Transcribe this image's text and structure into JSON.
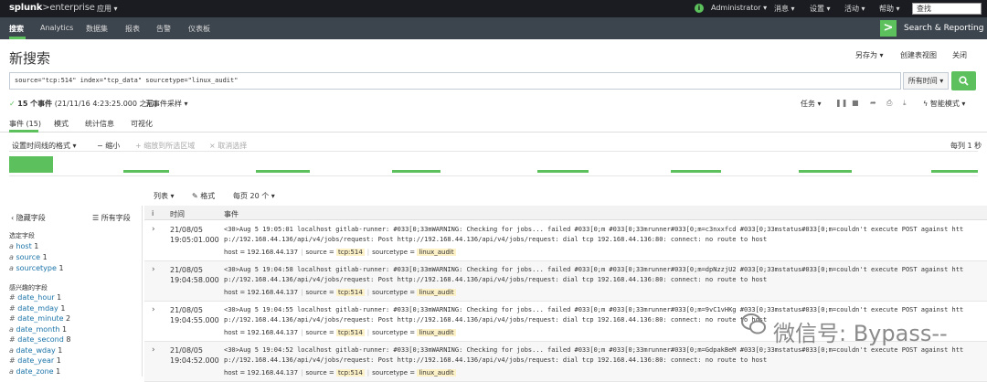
{
  "top": {
    "logo_main": "splunk",
    "logo_sub": ">enterprise",
    "app_menu": "应用 ▾",
    "user": "Administrator ▾",
    "messages": "消息 ▾",
    "settings": "设置 ▾",
    "activity": "活动 ▾",
    "help": "帮助 ▾",
    "find_placeholder": "查找",
    "status_glyph": "i"
  },
  "nav": {
    "items": [
      "搜索",
      "Analytics",
      "数据集",
      "报表",
      "告警",
      "仪表板"
    ],
    "app_glyph": ">",
    "app_name": "Search & Reporting"
  },
  "page": {
    "title": "新搜索",
    "save_as": "另存为 ▾",
    "create_dashboard": "创建表视图",
    "close": "关闭"
  },
  "search": {
    "query": "source=\"tcp:514\" index=\"tcp_data\" sourcetype=\"linux_audit\"",
    "time_range": "所有时间 ▾"
  },
  "meta": {
    "check": "✓",
    "count": "15 个事件",
    "time": "(21/11/16 4:23:25.000 之前)",
    "sampling": "无事件采样 ▾",
    "job": "任务 ▾",
    "mode": "智能模式 ▾"
  },
  "tabs": [
    "事件 (15)",
    "模式",
    "统计信息",
    "可视化"
  ],
  "timeline_ctrl": {
    "format": "设置时间线的格式 ▾",
    "zoom_out": "− 缩小",
    "zoom_sel": "+ 缩放到所选区域",
    "deselect": "× 取消选择",
    "scale": "每列 1 秒"
  },
  "timeline_data": {
    "bars": [
      {
        "start": 0.0,
        "end": 0.045,
        "height": 1.0
      },
      {
        "start": 0.118,
        "end": 0.165,
        "height": 0.15
      },
      {
        "start": 0.255,
        "end": 0.31,
        "height": 0.15
      },
      {
        "start": 0.395,
        "end": 0.445,
        "height": 0.15
      },
      {
        "start": 0.545,
        "end": 0.598,
        "height": 0.15
      },
      {
        "start": 0.683,
        "end": 0.735,
        "height": 0.15
      },
      {
        "start": 0.815,
        "end": 0.87,
        "height": 0.15
      },
      {
        "start": 0.952,
        "end": 1.0,
        "height": 0.15
      }
    ]
  },
  "results_ctrl": {
    "list": "列表 ▾",
    "format": "✎ 格式",
    "per_page": "每页 20 个 ▾"
  },
  "sidebar": {
    "hide_fields": "‹ 隐藏字段",
    "all_fields": "☰ 所有字段",
    "selected_title": "选定字段",
    "interesting_title": "感兴趣的字段",
    "selected": [
      {
        "type": "a",
        "name": "host",
        "count": "1"
      },
      {
        "type": "a",
        "name": "source",
        "count": "1"
      },
      {
        "type": "a",
        "name": "sourcetype",
        "count": "1"
      }
    ],
    "interesting": [
      {
        "type": "#",
        "name": "date_hour",
        "count": "1"
      },
      {
        "type": "#",
        "name": "date_mday",
        "count": "1"
      },
      {
        "type": "#",
        "name": "date_minute",
        "count": "2"
      },
      {
        "type": "a",
        "name": "date_month",
        "count": "1"
      },
      {
        "type": "#",
        "name": "date_second",
        "count": "8"
      },
      {
        "type": "a",
        "name": "date_wday",
        "count": "1"
      },
      {
        "type": "#",
        "name": "date_year",
        "count": "1"
      },
      {
        "type": "a",
        "name": "date_zone",
        "count": "1"
      }
    ]
  },
  "table": {
    "col_info": "i",
    "col_time": "时间",
    "col_event": "事件",
    "expand_glyph": "›",
    "rows": [
      {
        "date": "21/08/05",
        "time": "19:05:01.000",
        "line1": "<30>Aug  5 19:05:01 localhost gitlab-runner: #033[0;33mWARNING: Checking for jobs... failed              #033[0;m  #033[0;33mrunner#033[0;m=c3nxxfcd #033[0;33mstatus#033[0;m=couldn't execute POST against htt",
        "line2": "p://192.168.44.136/api/v4/jobs/request: Post http://192.168.44.136/api/v4/jobs/request: dial tcp 192.168.44.136:80: connect: no route to host",
        "host": "host = 192.168.44.137",
        "source_label": "source =",
        "source_val": "tcp:514",
        "st_label": "sourcetype =",
        "st_val": "linux_audit"
      },
      {
        "date": "21/08/05",
        "time": "19:04:58.000",
        "line1": "<30>Aug  5 19:04:58 localhost gitlab-runner: #033[0;33mWARNING: Checking for jobs... failed              #033[0;m  #033[0;33mrunner#033[0;m=dpNzzjU2 #033[0;33mstatus#033[0;m=couldn't execute POST against htt",
        "line2": "p://192.168.44.136/api/v4/jobs/request: Post http://192.168.44.136/api/v4/jobs/request: dial tcp 192.168.44.136:80: connect: no route to host",
        "host": "host = 192.168.44.137",
        "source_label": "source =",
        "source_val": "tcp:514",
        "st_label": "sourcetype =",
        "st_val": "linux_audit"
      },
      {
        "date": "21/08/05",
        "time": "19:04:55.000",
        "line1": "<30>Aug  5 19:04:55 localhost gitlab-runner: #033[0;33mWARNING: Checking for jobs... failed              #033[0;m  #033[0;33mrunner#033[0;m=9vC1vHKg #033[0;33mstatus#033[0;m=couldn't execute POST against htt",
        "line2": "p://192.168.44.136/api/v4/jobs/request: Post http://192.168.44.136/api/v4/jobs/request: dial tcp 192.168.44.136:80: connect: no route to host",
        "host": "host = 192.168.44.137",
        "source_label": "source =",
        "source_val": "tcp:514",
        "st_label": "sourcetype =",
        "st_val": "linux_audit"
      },
      {
        "date": "21/08/05",
        "time": "19:04:52.000",
        "line1": "<30>Aug  5 19:04:52 localhost gitlab-runner: #033[0;33mWARNING: Checking for jobs... failed              #033[0;m  #033[0;33mrunner#033[0;m=GdpakBeM #033[0;33mstatus#033[0;m=couldn't execute POST against htt",
        "line2": "p://192.168.44.136/api/v4/jobs/request: Post http://192.168.44.136/api/v4/jobs/request: dial tcp 192.168.44.136:80: connect: no route to host",
        "host": "host = 192.168.44.137",
        "source_label": "source =",
        "source_val": "tcp:514",
        "st_label": "sourcetype =",
        "st_val": "linux_audit"
      }
    ]
  },
  "watermark": "微信号: Bypass--",
  "colors": {
    "accent": "#5cc05c",
    "topbar": "#1a1c21",
    "navbar": "#3c444d",
    "link": "#1a73a8",
    "highlight": "#fdf1c7"
  }
}
